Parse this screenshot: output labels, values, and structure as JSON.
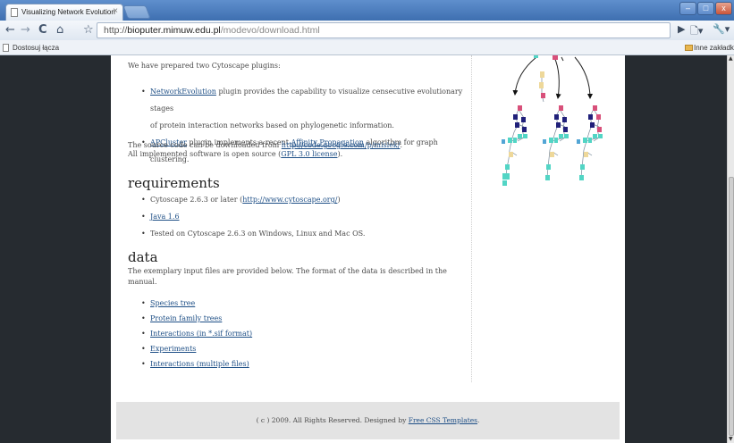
{
  "window": {
    "tab_title": "Visualizing Network Evolution",
    "close_glyph": "×",
    "min_glyph": "–",
    "max_glyph": "□",
    "close_win_glyph": "x"
  },
  "toolbar": {
    "back_glyph": "←",
    "forward_glyph": "→",
    "reload_glyph": "C",
    "home_glyph": "⌂",
    "star_glyph": "☆",
    "url_scheme": "http://",
    "url_host": "bioputer.mimuw.edu.pl",
    "url_path": "/modevo/download.html",
    "play_glyph": "▶",
    "page_menu_glyph": "🗋▾",
    "tools_menu_glyph": "🔧▾"
  },
  "bookmarks": {
    "left_label": "Dostosuj łącza",
    "right_label": "Inne zakładki"
  },
  "content": {
    "intro": "We have prepared two Cytoscape plugins:",
    "plugins": [
      {
        "link": "NetworkEvolution",
        "text": " plugin provides the capability to visualize censecutive evolutionary stages",
        "text2": "of protein interaction networks based on phylogenetic information."
      },
      {
        "link": "APCluster",
        "text": " plugin implements a recent ",
        "link2": "Affinity Propagation",
        "text2": " algorithm for graph clustering."
      }
    ],
    "source_prefix": "The source code can be downloaded from ",
    "source_link": "http://code.google.com/p/misiek/",
    "source_suffix": ".",
    "license_prefix": "All implemented software is open source (",
    "license_link": "GPL 3.0 license",
    "license_suffix": ").",
    "requirements_title": "requirements",
    "req_cytoscape_prefix": "Cytoscape 2.6.3 or later (",
    "req_cytoscape_link": "http://www.cytoscape.org/",
    "req_cytoscape_suffix": ")",
    "req_java": "Java 1.6",
    "req_tested": "Tested on Cytoscape 2.6.3 on Windows, Linux and Mac OS.",
    "data_title": "data",
    "data_desc": "The exemplary input files are provided below. The format of the data is described in the manual.",
    "data_links": [
      "Species tree",
      "Protein family trees",
      "Interactions (in *.sif format)",
      "Experiments",
      "Interactions (multiple files)"
    ]
  },
  "footer": {
    "prefix": "( c ) 2009. All Rights Reserved. Designed by ",
    "link": "Free CSS Templates",
    "suffix": "."
  },
  "colors": {
    "link": "#1e4f86",
    "sidebar_dark": "#262b30",
    "footer_bg": "#e3e3e3",
    "node_yellow": "#eed89a",
    "node_navy": "#20207a",
    "node_pink": "#d8507a",
    "node_teal": "#52d5c5"
  }
}
